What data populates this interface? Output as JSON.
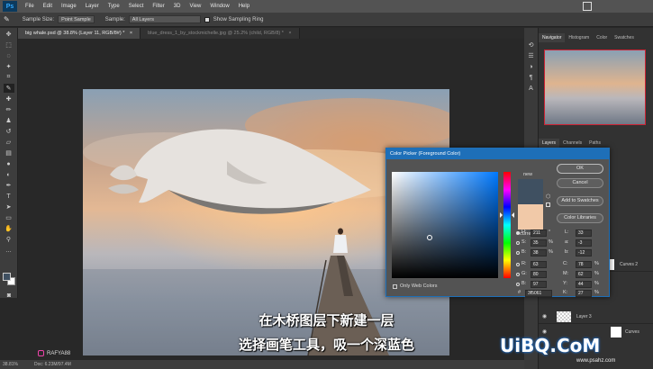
{
  "app": {
    "logo": "Ps",
    "restore_icon": "window-restore-icon"
  },
  "menu": [
    "File",
    "Edit",
    "Image",
    "Layer",
    "Type",
    "Select",
    "Filter",
    "3D",
    "View",
    "Window",
    "Help"
  ],
  "options": {
    "sample_size_label": "Sample Size:",
    "sample_size_value": "Point Sample",
    "sample_label": "Sample:",
    "sample_value": "All Layers",
    "show_ring_label": "Show Sampling Ring"
  },
  "tabs": [
    {
      "label": "big whale.psd @ 38.8% (Layer 11, RGB/8#) *",
      "close": "×",
      "active": true
    },
    {
      "label": "blue_dress_1_by_stockmichelle.jpg @ 25.2% (child, RGB/8) *",
      "close": "×",
      "active": false
    }
  ],
  "panels": {
    "top_tabs": [
      "Navigator",
      "Histogram",
      "Color",
      "Swatches"
    ],
    "mid_tabs": [
      "Layers",
      "Channels",
      "Paths"
    ],
    "layers": [
      {
        "name": "Curves 2"
      },
      {
        "name": "Layer 3"
      },
      {
        "name": "Curves"
      }
    ]
  },
  "status": {
    "zoom": "38.81%",
    "doc": "Doc: 6.23M/97.4M"
  },
  "dialog": {
    "title": "Color Picker (Foreground Color)",
    "new_label": "new",
    "current_label": "current",
    "buttons": {
      "ok": "OK",
      "cancel": "Cancel",
      "add_swatches": "Add to Swatches",
      "libraries": "Color Libraries"
    },
    "only_web": "Only Web Colors",
    "hsb": [
      {
        "label": "H:",
        "value": "211",
        "unit": "°"
      },
      {
        "label": "S:",
        "value": "35",
        "unit": "%"
      },
      {
        "label": "B:",
        "value": "38",
        "unit": "%"
      }
    ],
    "rgb": [
      {
        "label": "R:",
        "value": "63"
      },
      {
        "label": "G:",
        "value": "80"
      },
      {
        "label": "B:",
        "value": "97"
      }
    ],
    "lab": [
      {
        "label": "L:",
        "value": "33"
      },
      {
        "label": "a:",
        "value": "-3"
      },
      {
        "label": "b:",
        "value": "-12"
      }
    ],
    "cmyk": [
      {
        "label": "C:",
        "value": "78",
        "unit": "%"
      },
      {
        "label": "M:",
        "value": "62",
        "unit": "%"
      },
      {
        "label": "Y:",
        "value": "44",
        "unit": "%"
      },
      {
        "label": "K:",
        "value": "27",
        "unit": "%"
      }
    ],
    "hex_label": "#",
    "hex": "3f5061",
    "new_color": "#3f5061",
    "current_color": "#f1c9a8"
  },
  "watermark_left": "RAFYA88",
  "subtitles": [
    "在木桥图层下新建一层",
    "选择画笔工具，吸一个深蓝色"
  ],
  "watermark_right": "UiBQ.CoM",
  "watermark_url": "www.psahz.com"
}
